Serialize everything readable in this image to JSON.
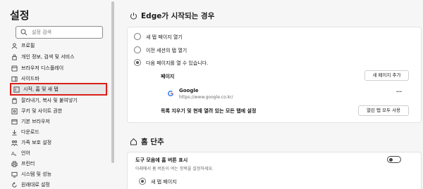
{
  "sidebar": {
    "title": "설정",
    "search_placeholder": "설정 검색",
    "items": [
      {
        "label": "프로필",
        "icon": "profile-icon"
      },
      {
        "label": "개인 정보, 검색 및 서비스",
        "icon": "privacy-lock-icon"
      },
      {
        "label": "브라우저 디스플레이",
        "icon": "appearance-icon"
      },
      {
        "label": "사이드바",
        "icon": "sidebar-icon"
      },
      {
        "label": "시작, 홈 및 새 탭",
        "icon": "start-home-icon"
      },
      {
        "label": "잘라내기, 복사 및 붙여넣기",
        "icon": "clipboard-icon"
      },
      {
        "label": "쿠키 및 사이트 권한",
        "icon": "cookie-icon"
      },
      {
        "label": "기본 브라우저",
        "icon": "browser-icon"
      },
      {
        "label": "다운로드",
        "icon": "download-icon"
      },
      {
        "label": "가족 보호 설정",
        "icon": "family-icon"
      },
      {
        "label": "언어",
        "icon": "language-icon"
      },
      {
        "label": "프린터",
        "icon": "printer-icon"
      },
      {
        "label": "시스템 및 성능",
        "icon": "system-icon"
      },
      {
        "label": "원래대로 설정",
        "icon": "reset-icon"
      }
    ],
    "active_index": 4
  },
  "startup": {
    "title": "Edge가 시작되는 경우",
    "options": [
      "새 탭 페이지 열기",
      "이전 세션의 탭 열기",
      "다음 페이지를 열 수 있습니다."
    ],
    "selected_index": 2,
    "pages_label": "페이지",
    "add_page_button": "새 페이지 추가",
    "page_name": "Google",
    "page_url": "https://www.google.co.kr/",
    "more_label": "...",
    "clear_note": "목록 지우기 및 현재 열려 있는 모든 탭에 설정",
    "use_all_tabs_button": "열린 탭 모두 사용"
  },
  "home": {
    "title": "홈 단추",
    "show_label": "도구 모음에 홈 버튼 표시",
    "show_desc": "아래에서 홈 버튼이 여는 항목을 설정하세요.",
    "toggle_on": false,
    "option_new_tab": "새 탭 페이지"
  },
  "colors": {
    "accent": "#1a6fd0",
    "highlight": "#d9201a"
  }
}
